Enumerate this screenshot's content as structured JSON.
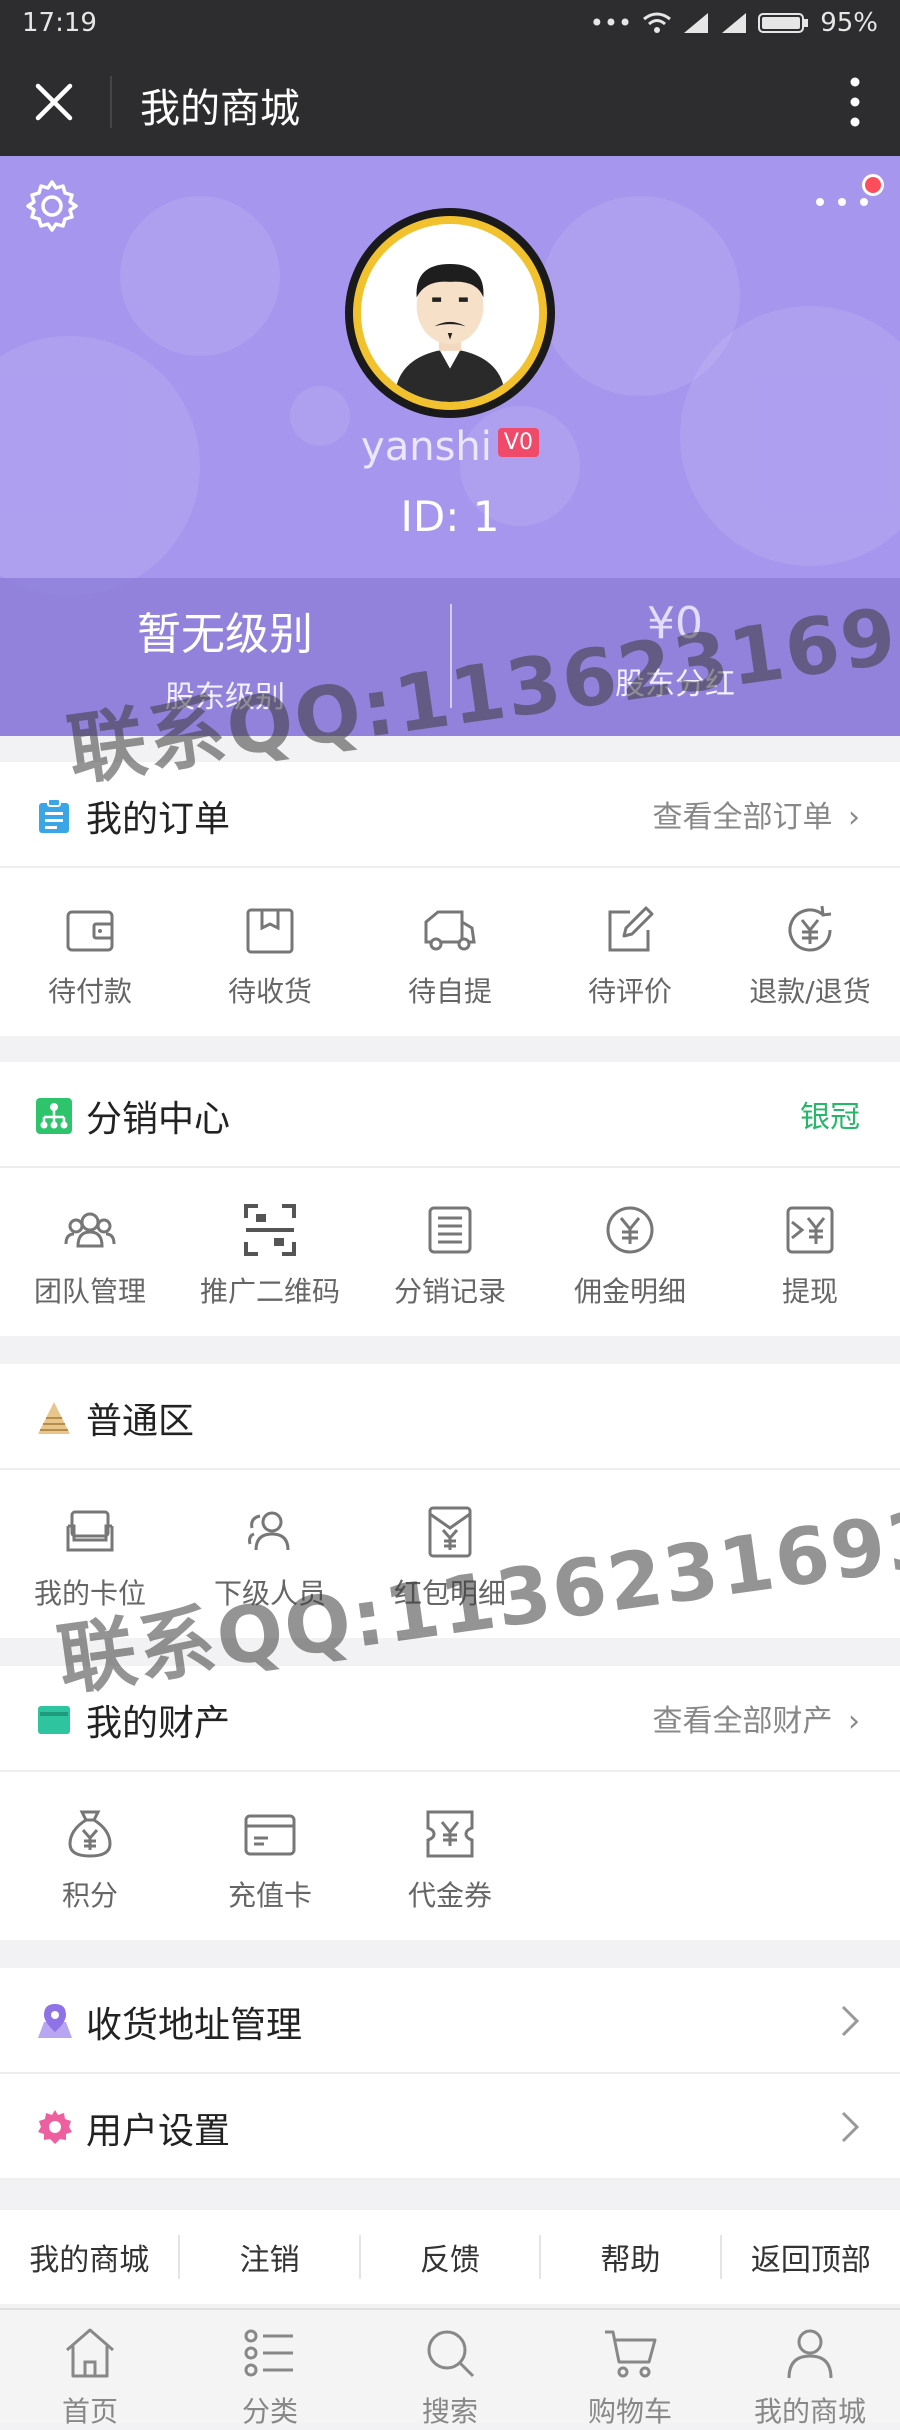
{
  "status": {
    "time": "17:19",
    "battery": "95%"
  },
  "titlebar": {
    "title": "我的商城"
  },
  "profile": {
    "username": "yanshi",
    "badge": "V0",
    "id_text": "ID: 1"
  },
  "stats": [
    {
      "value": "暂无级别",
      "label": "股东级别"
    },
    {
      "value": "¥0",
      "label": "股东分红"
    }
  ],
  "orders": {
    "title": "我的订单",
    "link": "查看全部订单",
    "items": [
      "待付款",
      "待收货",
      "待自提",
      "待评价",
      "退款/退货"
    ]
  },
  "distribution": {
    "title": "分销中心",
    "level": "银冠",
    "items": [
      "团队管理",
      "推广二维码",
      "分销记录",
      "佣金明细",
      "提现"
    ]
  },
  "normal": {
    "title": "普通区",
    "items": [
      "我的卡位",
      "下级人员",
      "红包明细"
    ]
  },
  "assets": {
    "title": "我的财产",
    "link": "查看全部财产",
    "items": [
      "积分",
      "充值卡",
      "代金券"
    ]
  },
  "rows": [
    "收货地址管理",
    "用户设置"
  ],
  "footer_links": [
    "我的商城",
    "注销",
    "反馈",
    "帮助",
    "返回顶部"
  ],
  "tabs": [
    "首页",
    "分类",
    "搜索",
    "购物车",
    "我的商城"
  ],
  "watermark": "联系QQ:1136231693",
  "colors": {
    "hero": "#a796ee",
    "level_green": "#28b66a",
    "badge_red": "#ef4a6a"
  }
}
